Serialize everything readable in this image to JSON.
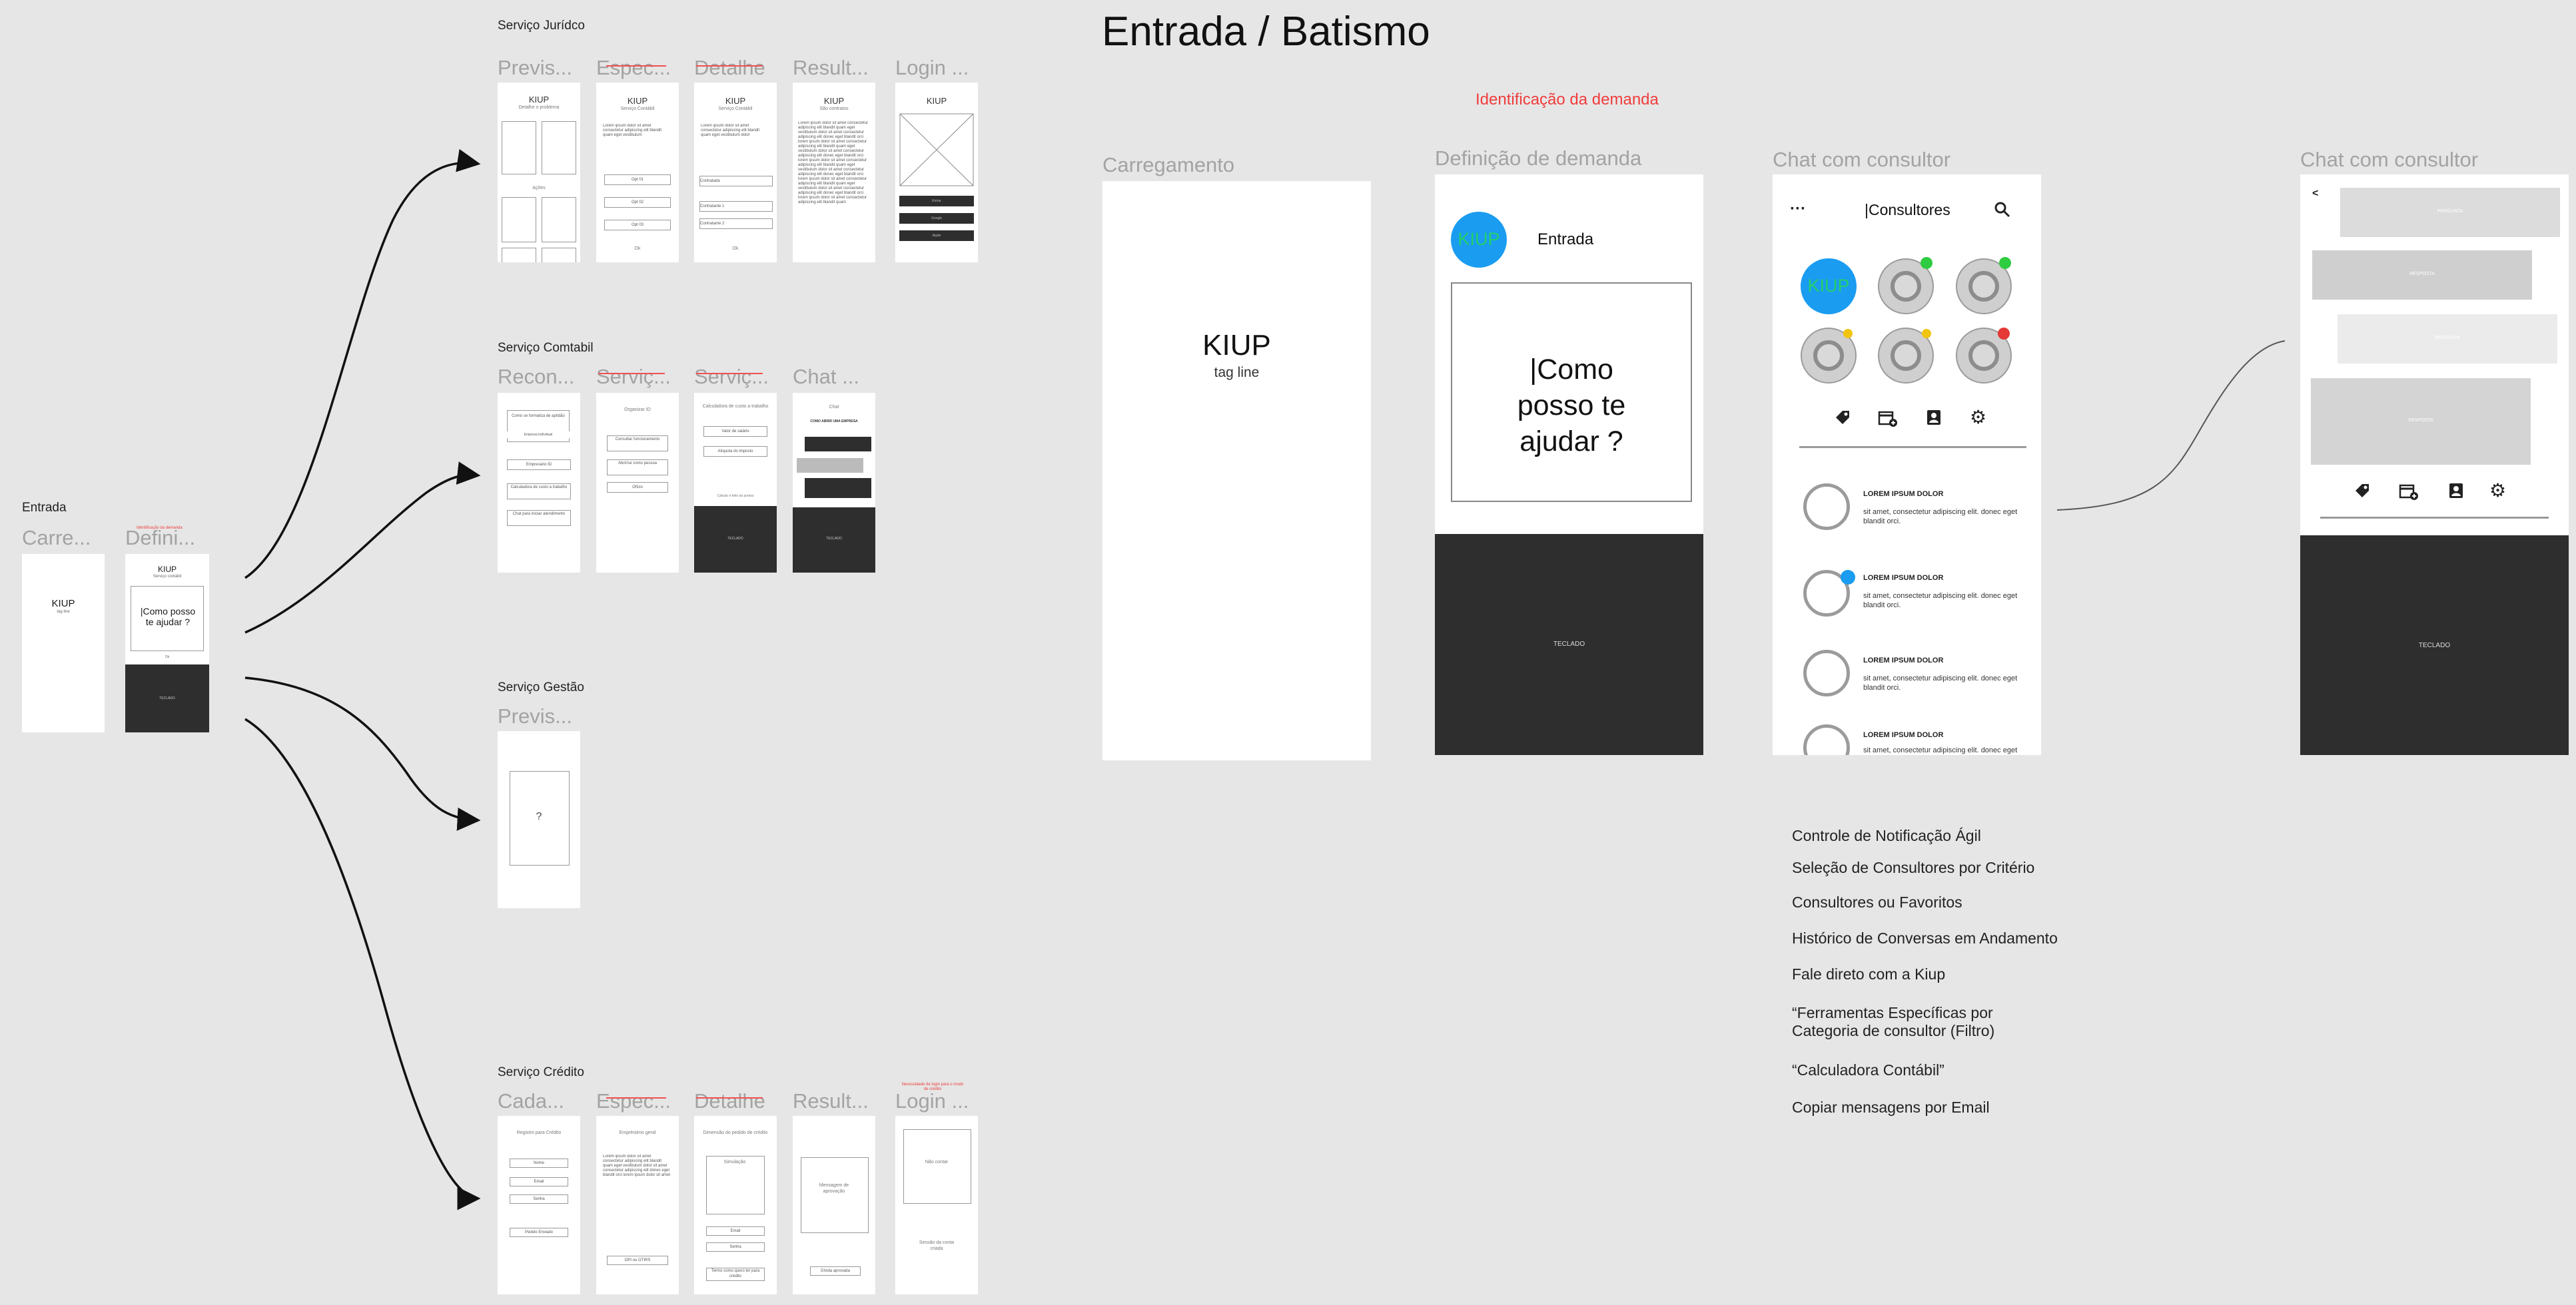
{
  "canvas": {
    "main_title": "Entrada / Batismo",
    "annotation_red": "Identificação da demanda"
  },
  "entrada": {
    "section": "Entrada",
    "frame1_label": "Carre...",
    "frame2_label": "Defini...",
    "frame2_red_note": "Identificação da demanda",
    "frame1_logo": "KIUP",
    "frame1_tag": "tag line",
    "frame2_logo": "KIUP",
    "frame2_sub": "Serviço contábil",
    "frame2_prompt": "|Como posso te ajudar ?",
    "frame2_small": "Ok",
    "frame2_keyboard": "TECLADO"
  },
  "juridico": {
    "section": "Serviço Jurídco",
    "labels": [
      "Previs...",
      "Espec...",
      "Detalhe",
      "Result...",
      "Login ..."
    ],
    "frame_titles": [
      "KIUP",
      "KIUP",
      "KIUP",
      "KIUP",
      "KIUP"
    ],
    "frame_subs": [
      "Detalhe o problema",
      "Serviço Contábil",
      "Serviço Contábil",
      "São contratos",
      ""
    ],
    "f1_text": "Ações",
    "f2_buttons": [
      "Opt 01",
      "Opt 02",
      "Opt 03"
    ],
    "f2_small": "Ok",
    "f3_fields": [
      "Contratada",
      "Contratante 1",
      "Contratante 2"
    ],
    "f3_small": "Ok",
    "f5_buttons": [
      "Entrar",
      "Google",
      "Apple"
    ]
  },
  "contabil": {
    "section": "Serviço Comtabil",
    "labels": [
      "Recon...",
      "Serviç...",
      "Serviç...",
      "Chat ..."
    ],
    "f1_items": [
      "Como se formaliza de aptidão",
      "Empresa Individual",
      "Empresário ID",
      "Calculadora de custo a trabalho",
      "Chat para iniciar atendimento"
    ],
    "f2_title": "Organizar ID",
    "f2_items": [
      "Consultar funcionamento",
      "Abrir/se como pessoa",
      "Ofício"
    ],
    "f3_title": "Calculadora de custo a trabalho",
    "f3_items": [
      "Valor de salário",
      "Alíquota do imposto"
    ],
    "f3_small": "Cálculo é feito de pontos",
    "f3_dark": "TECLADO",
    "f4_title": "Chat",
    "f4_sub": "COMO ABRIR UMA EMPRESA",
    "f4_dark": "TECLADO"
  },
  "gestao": {
    "section": "Serviço Gestão",
    "label": "Previs...",
    "placeholder": "?"
  },
  "credito": {
    "section": "Serviço Crédito",
    "labels": [
      "Cada...",
      "Espec...",
      "Detalhe",
      "Result...",
      "Login ..."
    ],
    "red_note": "Necessidade de login para o modo de crédito",
    "f1_title": "Registro para Crédito",
    "f1_items": [
      "Nome",
      "Email",
      "Senha"
    ],
    "f1_button": "Pedido Enviado",
    "f2_title": "Empréstimo geral",
    "f2_button": "OPI ou OTIRS",
    "f3_title": "Dimensão do pedido de crédito",
    "f3_box": "Simulação",
    "f3_items": [
      "Email",
      "Senha"
    ],
    "f3_button": "Termo como quero ter para crédito",
    "f4_box": "Mensagem de aprovação",
    "f4_button": "Dívida aprovada",
    "f5_box": "Não contar",
    "f5_text": "Sessão da conta criada"
  },
  "carregamento": {
    "label": "Carregamento",
    "logo": "KIUP",
    "tagline": "tag line"
  },
  "definicao": {
    "label": "Definição de demanda",
    "avatar_text": "KIUP",
    "header_text": "Entrada",
    "prompt": "|Como posso te ajudar ?",
    "keyboard": "TECLADO"
  },
  "chat1": {
    "label": "Chat com consultor",
    "menu_icon": "more-horizontal-icon",
    "search_icon": "search-icon",
    "title": "|Consultores",
    "avatar_text": "KIUP",
    "status_colors": [
      "#2ecc40",
      "#2ecc40",
      "#f1c40f",
      "#f1c40f",
      "#e53935"
    ],
    "accent_color": "#1a9cf0",
    "kiup_text_color": "#22d06a",
    "tabs": [
      "tag-icon",
      "calendar-add-icon",
      "contact-icon",
      "gear-icon"
    ],
    "messages": [
      {
        "title": "LOREM IPSUM DOLOR",
        "text": "sit amet, consectetur adipiscing elit. donec eget blandit orci."
      },
      {
        "title": "LOREM IPSUM DOLOR",
        "text": "sit amet, consectetur adipiscing elit. donec eget blandit orci."
      },
      {
        "title": "LOREM IPSUM DOLOR",
        "text": "sit amet, consectetur adipiscing elit. donec eget blandit orci."
      },
      {
        "title": "LOREM IPSUM DOLOR",
        "text": "sit amet, consectetur adipiscing elit. donec eget"
      }
    ]
  },
  "chat2": {
    "label": "Chat com consultor",
    "back": "<",
    "bubbles": [
      "PERGUNTA",
      "RESPOSTA",
      "PERGUNTA",
      "RESPOSTA"
    ],
    "keyboard": "TECLADO"
  },
  "features": [
    "Controle de Notificação Ágil",
    "Seleção de Consultores por Critério",
    "Consultores ou Favoritos",
    "Histórico de Conversas em Andamento",
    "Fale direto com a Kiup",
    "“Ferramentas Específicas por Categoria de consultor (Filtro)",
    "“Calculadora Contábil”",
    "Copiar mensagens por Email"
  ]
}
